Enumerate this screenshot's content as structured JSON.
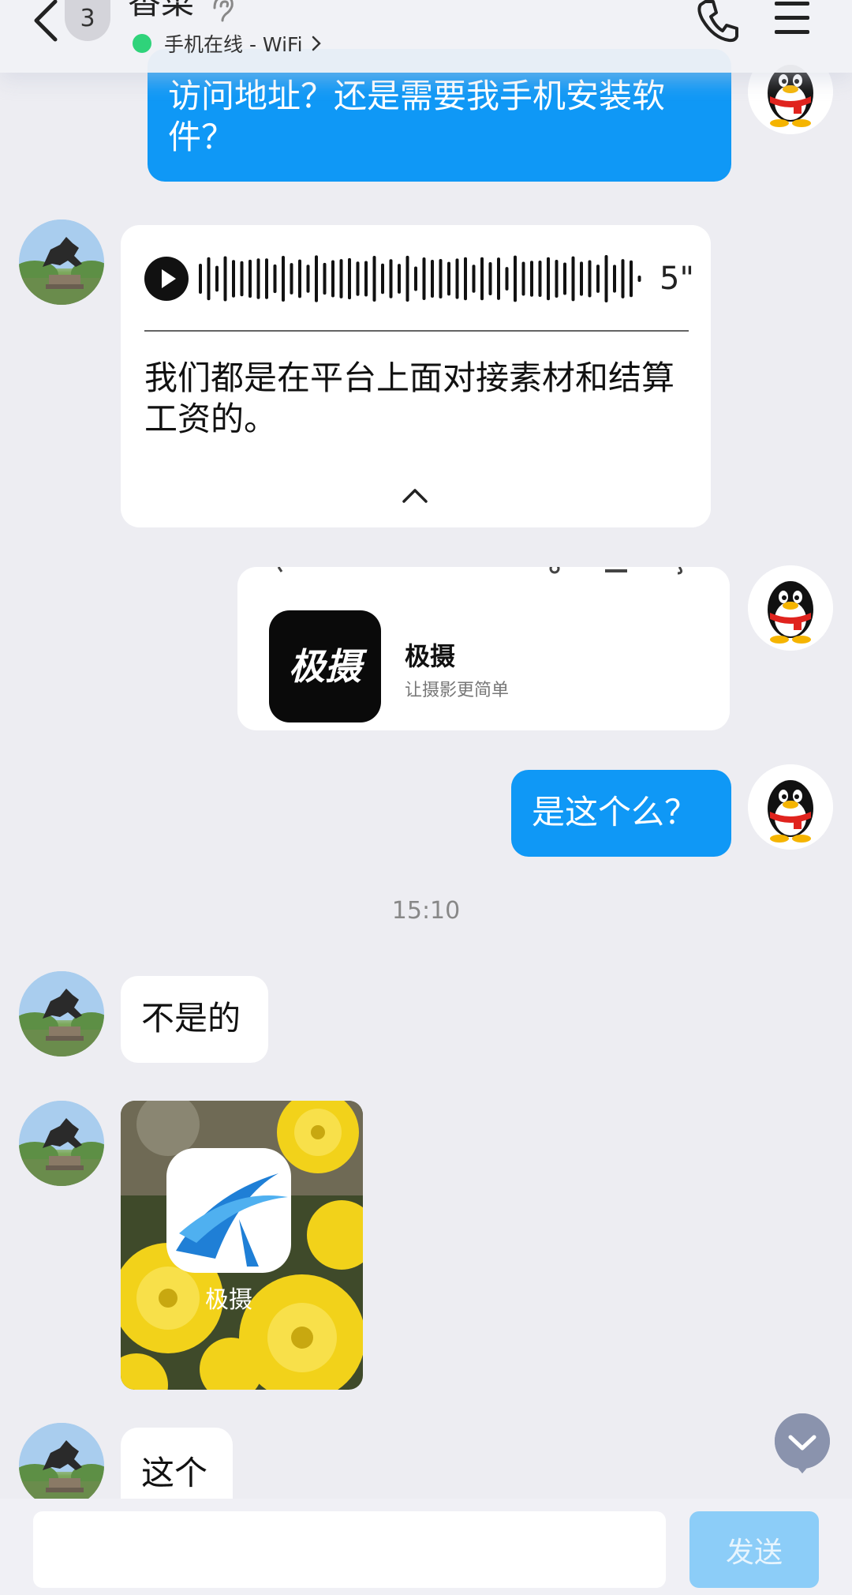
{
  "header": {
    "back_icon": "chevron-left-icon",
    "unread_badge": "3",
    "contact_name": "香菜",
    "status_text": "手机在线 - WiFi",
    "status_color": "#2fd37a",
    "phone_icon": "phone-icon",
    "menu_icon": "menu-icon"
  },
  "messages": {
    "m1_text": "访问地址？还是需要我手机安装软件？",
    "voice": {
      "duration": "5\"",
      "transcript": "我们都是在平台上面对接素材和结算工资的。"
    },
    "app_card": {
      "icon_text": "极摄",
      "name": "极摄",
      "slogan": "让摄影更简单"
    },
    "m4_text": "是这个么？",
    "time": "15:10",
    "m5_text": "不是的",
    "image_caption": "极摄",
    "m7_text": "这个"
  },
  "composer": {
    "input_value": "",
    "input_placeholder": "",
    "send_label": "发送"
  },
  "colors": {
    "my_bubble": "#0f98f6",
    "send_button": "#8ccdf8",
    "background": "#ededf2"
  }
}
